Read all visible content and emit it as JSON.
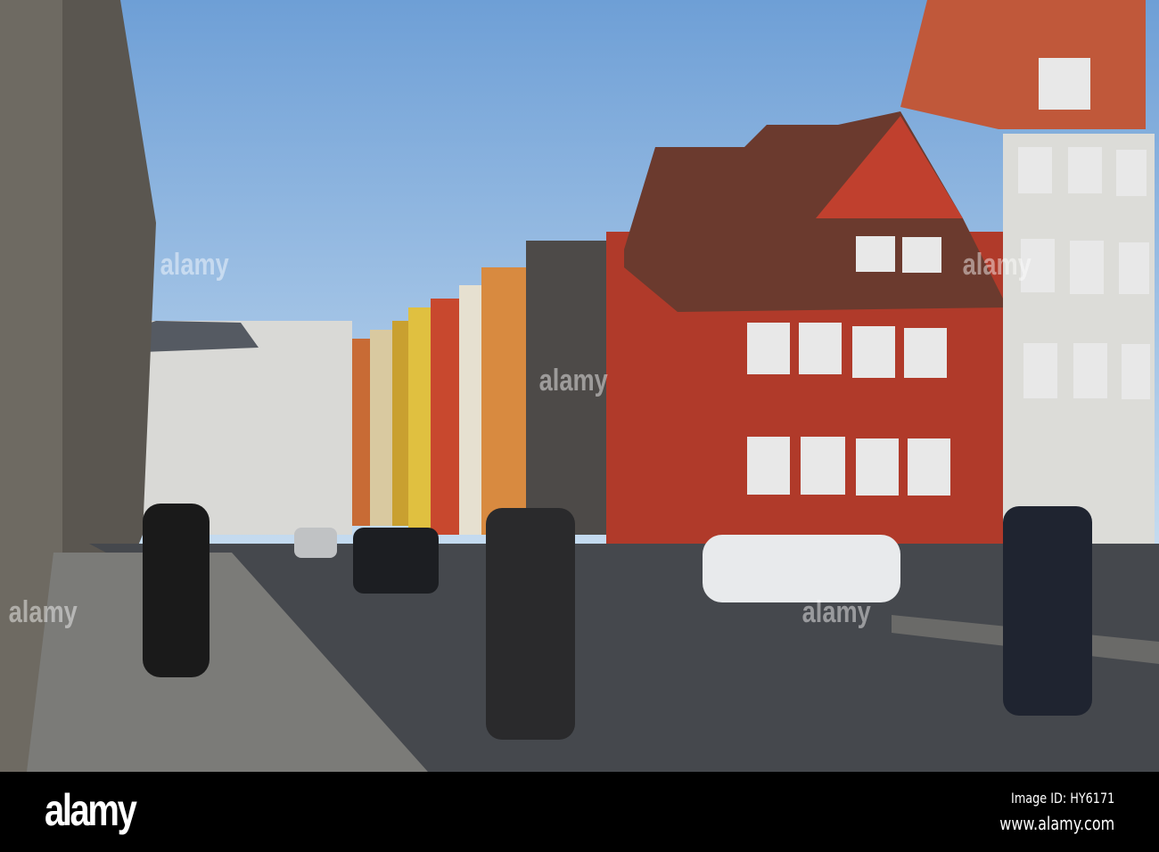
{
  "photo": {
    "subject": "street-scene"
  },
  "watermark": {
    "text": "alamy"
  },
  "footer": {
    "logo": "alamy",
    "image_id": "Image ID: HY6171",
    "website": "www.alamy.com"
  },
  "colors": {
    "sky": "#8fb8e0",
    "red_house": "#b83a2a",
    "road": "#4a4d52",
    "white_house": "#dcdcd8"
  }
}
